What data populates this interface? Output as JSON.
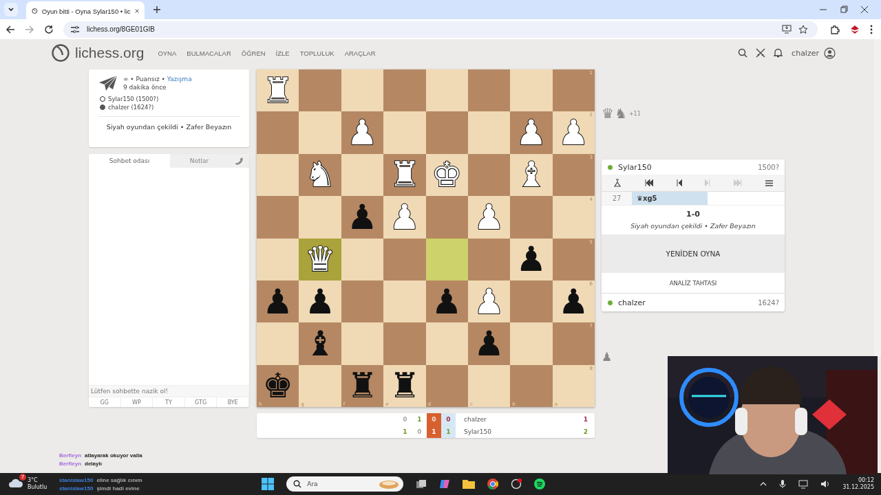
{
  "browser": {
    "tab_title": "Oyun bitti - Oyna Sylar150 • lic",
    "url": "lichess.org/8GE01GIB"
  },
  "site": {
    "logo": "lichess.org",
    "nav": [
      "OYNA",
      "BULMACALAR",
      "ÖĞREN",
      "İZLE",
      "TOPLULUK",
      "ARAÇLAR"
    ],
    "user": "chalzer"
  },
  "game_info": {
    "mode": "∞ • Puansız •",
    "variant_link": "Yazışma",
    "time_ago": "9 dakika önce",
    "players": [
      {
        "name": "Sylar150 (1500?)",
        "is_white": true
      },
      {
        "name": "chalzer (1624?)",
        "is_white": false
      }
    ],
    "status": "Siyah oyundan çekildi • Zafer Beyazın"
  },
  "chat": {
    "tabs": [
      {
        "label": "Sohbet odası",
        "selected": true
      },
      {
        "label": "Notlar",
        "selected": false
      }
    ],
    "placeholder": "Lütfen sohbette nazik ol!",
    "presets": [
      "GG",
      "WP",
      "TY",
      "GTG",
      "BYE"
    ]
  },
  "board": {
    "files": [
      "h",
      "g",
      "f",
      "e",
      "d",
      "c",
      "b",
      "a"
    ],
    "rows": [
      {
        "rank": "1",
        "cells": [
          {
            "piece": "♜",
            "is_white": true,
            "last_move": false
          },
          {
            "last_move": false
          },
          {
            "last_move": false
          },
          {
            "last_move": false
          },
          {
            "last_move": false
          },
          {
            "last_move": false
          },
          {
            "last_move": false
          },
          {
            "last_move": false
          }
        ]
      },
      {
        "rank": "2",
        "cells": [
          {
            "last_move": false
          },
          {
            "last_move": false
          },
          {
            "piece": "♟",
            "is_white": true,
            "last_move": false
          },
          {
            "last_move": false
          },
          {
            "last_move": false
          },
          {
            "last_move": false
          },
          {
            "piece": "♟",
            "is_white": true,
            "last_move": false
          },
          {
            "piece": "♟",
            "is_white": true,
            "last_move": false
          }
        ]
      },
      {
        "rank": "3",
        "cells": [
          {
            "last_move": false
          },
          {
            "piece": "♞",
            "is_white": true,
            "last_move": false
          },
          {
            "last_move": false
          },
          {
            "piece": "♜",
            "is_white": true,
            "last_move": false
          },
          {
            "piece": "♚",
            "is_white": true,
            "last_move": false
          },
          {
            "last_move": false
          },
          {
            "piece": "♝",
            "is_white": true,
            "last_move": false
          },
          {
            "last_move": false
          }
        ]
      },
      {
        "rank": "4",
        "cells": [
          {
            "last_move": false
          },
          {
            "last_move": false
          },
          {
            "piece": "♟",
            "is_white": false,
            "last_move": false
          },
          {
            "piece": "♟",
            "is_white": true,
            "last_move": false
          },
          {
            "last_move": false
          },
          {
            "piece": "♟",
            "is_white": true,
            "last_move": false
          },
          {
            "last_move": false
          },
          {
            "last_move": false
          }
        ]
      },
      {
        "rank": "5",
        "cells": [
          {
            "last_move": false
          },
          {
            "piece": "♛",
            "is_white": true,
            "last_move": true
          },
          {
            "last_move": false
          },
          {
            "last_move": false
          },
          {
            "last_move": true
          },
          {
            "last_move": false
          },
          {
            "piece": "♟",
            "is_white": false,
            "last_move": false
          },
          {
            "last_move": false
          }
        ]
      },
      {
        "rank": "6",
        "cells": [
          {
            "piece": "♟",
            "is_white": false,
            "last_move": false
          },
          {
            "piece": "♟",
            "is_white": false,
            "last_move": false
          },
          {
            "last_move": false
          },
          {
            "last_move": false
          },
          {
            "piece": "♟",
            "is_white": false,
            "last_move": false
          },
          {
            "piece": "♟",
            "is_white": true,
            "last_move": false
          },
          {
            "last_move": false
          },
          {
            "piece": "♟",
            "is_white": false,
            "last_move": false
          }
        ]
      },
      {
        "rank": "7",
        "cells": [
          {
            "last_move": false
          },
          {
            "piece": "♝",
            "is_white": false,
            "last_move": false
          },
          {
            "last_move": false
          },
          {
            "last_move": false
          },
          {
            "last_move": false
          },
          {
            "piece": "♟",
            "is_white": false,
            "last_move": false
          },
          {
            "last_move": false
          },
          {
            "last_move": false
          }
        ]
      },
      {
        "rank": "8",
        "cells": [
          {
            "piece": "♚",
            "is_white": false,
            "last_move": false
          },
          {
            "last_move": false
          },
          {
            "piece": "♜",
            "is_white": false,
            "last_move": false
          },
          {
            "piece": "♜",
            "is_white": false,
            "last_move": false
          },
          {
            "last_move": false
          },
          {
            "last_move": false
          },
          {
            "last_move": false
          },
          {
            "last_move": false
          }
        ]
      }
    ]
  },
  "material_top": {
    "pieces": [
      "♛",
      "♞"
    ],
    "diff": "+11"
  },
  "material_bottom": {
    "pieces": [
      "♟"
    ]
  },
  "top_player": {
    "name": "Sylar150",
    "rating": "1500?",
    "online": true
  },
  "moves": [
    {
      "number": "27",
      "move": "♛xg5",
      "selected": true
    }
  ],
  "result": {
    "score": "1-0",
    "status": "Siyah oyundan çekildi • Zafer Beyazın"
  },
  "buttons": {
    "rematch": "YENİDEN OYNA",
    "analysis": "ANALİZ TAHTASI"
  },
  "bottom_player": {
    "name": "chalzer",
    "rating": "1624?",
    "online": true
  },
  "crosstable": {
    "columns": [
      {
        "kind": "past",
        "cells": [
          {
            "text": "0",
            "won": false
          },
          {
            "text": "1",
            "won": true
          }
        ]
      },
      {
        "kind": "past",
        "cells": [
          {
            "text": "1",
            "won": true
          },
          {
            "text": "0",
            "won": false
          }
        ]
      },
      {
        "kind": "current",
        "cells": [
          {
            "text": "0",
            "won": false
          },
          {
            "text": "1",
            "won": true
          }
        ]
      },
      {
        "kind": "matchup",
        "cells": [
          {
            "text": "0",
            "won": false
          },
          {
            "text": "1",
            "won": true
          }
        ]
      }
    ],
    "players": [
      {
        "name": "chalzer",
        "total": "1",
        "leading": false
      },
      {
        "name": "Sylar150",
        "total": "2",
        "leading": true
      }
    ]
  },
  "stream_chat": [
    {
      "user": "Berfleyn",
      "text": "atlayarak okuyor valla",
      "color": "#a66be0"
    },
    {
      "user": "Berfleyn",
      "text": "delaylı",
      "color": "#a66be0"
    },
    {
      "user": "stanislaw150",
      "text": "eline sağlık cınım",
      "color": "#3d7fd9"
    },
    {
      "user": "stanislaw150",
      "text": "şimdi hadi evine",
      "color": "#3d7fd9"
    }
  ],
  "taskbar": {
    "weather_badge": "7",
    "temperature": "3°C",
    "weather": "Bulutlu",
    "search_placeholder": "Ara",
    "time": "00:12",
    "date": "31.12.2025"
  }
}
